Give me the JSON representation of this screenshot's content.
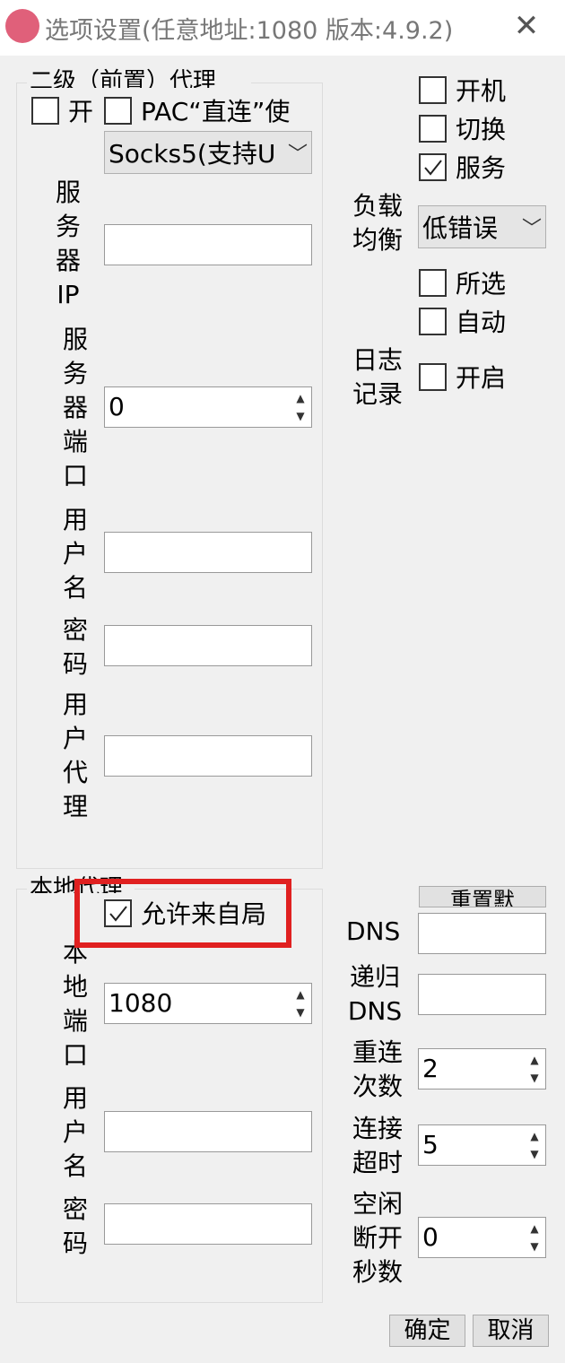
{
  "window": {
    "title": "选项设置(任意地址:1080 版本:4.9.2)",
    "close_symbol": "✕"
  },
  "upstream_proxy": {
    "group_title": "二级（前置）代理",
    "enable_label": "开",
    "enable_checked": false,
    "pac_direct_label": "PAC“直连”使",
    "pac_direct_checked": false,
    "proxy_type": "Socks5(支持U",
    "server_ip_label": "服务器IP",
    "server_ip_value": "",
    "server_port_label": "服务器端口",
    "server_port_value": "0",
    "username_label": "用户名",
    "username_value": "",
    "password_label": "密码",
    "password_value": "",
    "user_agent_label": "用户代理",
    "user_agent_value": ""
  },
  "general": {
    "autostart_label": "开机",
    "autostart_checked": false,
    "switch_label": "切换",
    "switch_checked": false,
    "service_label": "服务",
    "service_checked": true,
    "load_balance_label": "负载均衡",
    "load_balance_value": "低错误",
    "selected_label": "所选",
    "selected_checked": false,
    "auto_label": "自动",
    "auto_checked": false,
    "log_label": "日志记录",
    "log_enable_label": "开启",
    "log_enable_checked": false
  },
  "local_proxy": {
    "group_title": "本地代理",
    "allow_lan_label": "允许来自局",
    "allow_lan_checked": true,
    "port_label": "本地端口",
    "port_value": "1080",
    "username_label": "用户名",
    "username_value": "",
    "password_label": "密码",
    "password_value": ""
  },
  "network": {
    "reset_button": "重置默",
    "dns_label": "DNS",
    "dns_value": "",
    "recursive_dns_label": "递归DNS",
    "recursive_dns_value": "",
    "reconnect_label": "重连次数",
    "reconnect_value": "2",
    "timeout_label": "连接超时",
    "timeout_value": "5",
    "idle_label": "空闲断开秒数",
    "idle_value": "0"
  },
  "footer": {
    "ok_button": "确定",
    "cancel_button": "取消"
  },
  "colors": {
    "highlight": "#e02020",
    "app_icon": "#e0607a"
  }
}
